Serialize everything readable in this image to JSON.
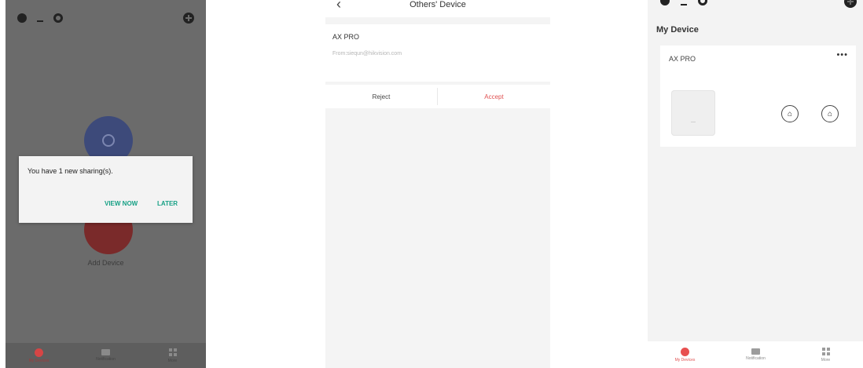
{
  "screen1": {
    "dialog": {
      "message": "You have 1 new sharing(s).",
      "view_now": "VIEW NOW",
      "later": "LATER"
    },
    "add_device_label": "Add Device",
    "tabs": [
      {
        "label": "My Devices"
      },
      {
        "label": "Notification"
      },
      {
        "label": "More"
      }
    ]
  },
  "screen2": {
    "back_icon": "chevron-left-icon",
    "title": "Others' Device",
    "device_name": "AX PRO",
    "from": "From:siequn@hikvision.com",
    "reject_label": "Reject",
    "accept_label": "Accept",
    "accept_color": "#e05252"
  },
  "screen3": {
    "section_title": "My Device",
    "device_name": "AX PRO",
    "more_label": "•••",
    "tabs": [
      {
        "label": "My Devices"
      },
      {
        "label": "Notification"
      },
      {
        "label": "More"
      }
    ]
  },
  "colors": {
    "accent_teal": "#16a085",
    "accent_red": "#e05252"
  }
}
